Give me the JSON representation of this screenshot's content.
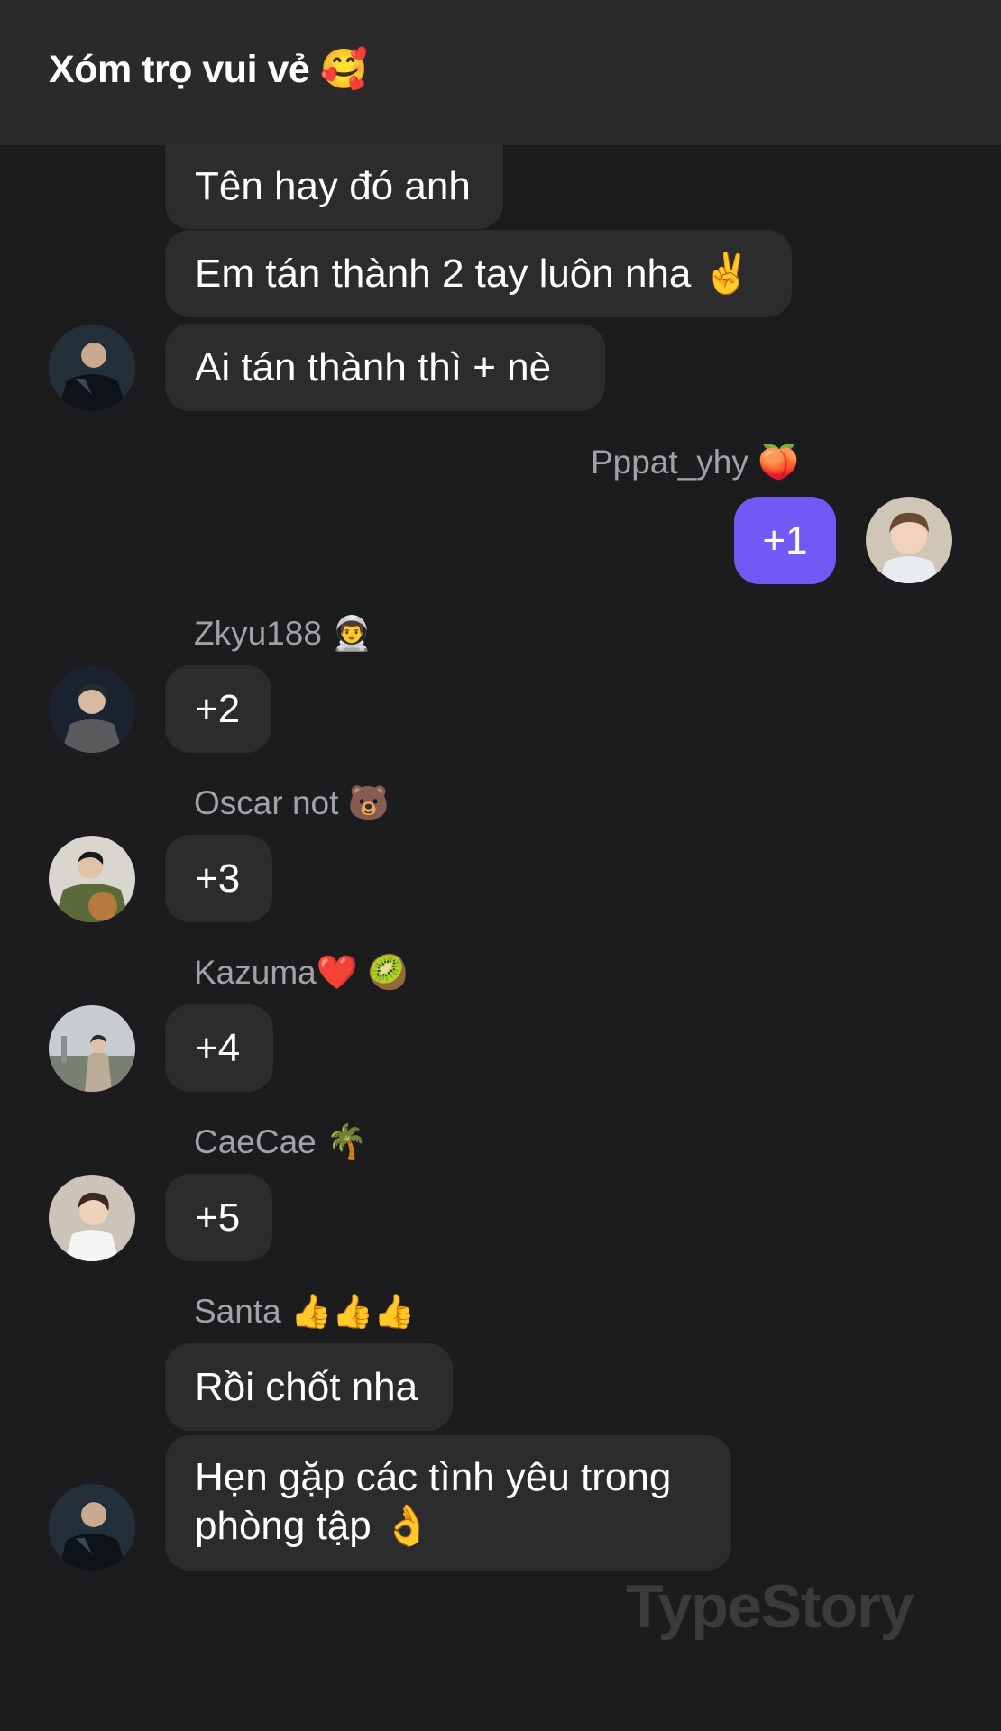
{
  "header": {
    "title": "Xóm trọ vui vẻ 🥰"
  },
  "messages": {
    "m1": {
      "text": "Tên hay đó anh"
    },
    "m2": {
      "text": "Em tán thành 2 tay luôn nha ✌️"
    },
    "m3": {
      "text": "Ai tán thành thì + nè"
    },
    "out1": {
      "sender": "Pppat_yhy 🍑",
      "text": "+1"
    },
    "z": {
      "sender": "Zkyu188 👨‍🚀",
      "text": "+2"
    },
    "o": {
      "sender": "Oscar not 🐻",
      "text": "+3"
    },
    "k": {
      "sender": "Kazuma❤️ 🥝",
      "text": "+4"
    },
    "c": {
      "sender": "CaeCae 🌴",
      "text": "+5"
    },
    "s": {
      "sender": "Santa 👍👍👍",
      "text1": "Rồi chốt nha",
      "text2": "Hẹn gặp các tình yêu trong phòng tập 👌"
    }
  },
  "watermark": "TypeStory",
  "colors": {
    "background": "#1c1c1e",
    "header": "#2a2a2c",
    "bubble_in": "#2c2c2e",
    "bubble_out": "#7259f5",
    "name": "#a1a1a6"
  }
}
